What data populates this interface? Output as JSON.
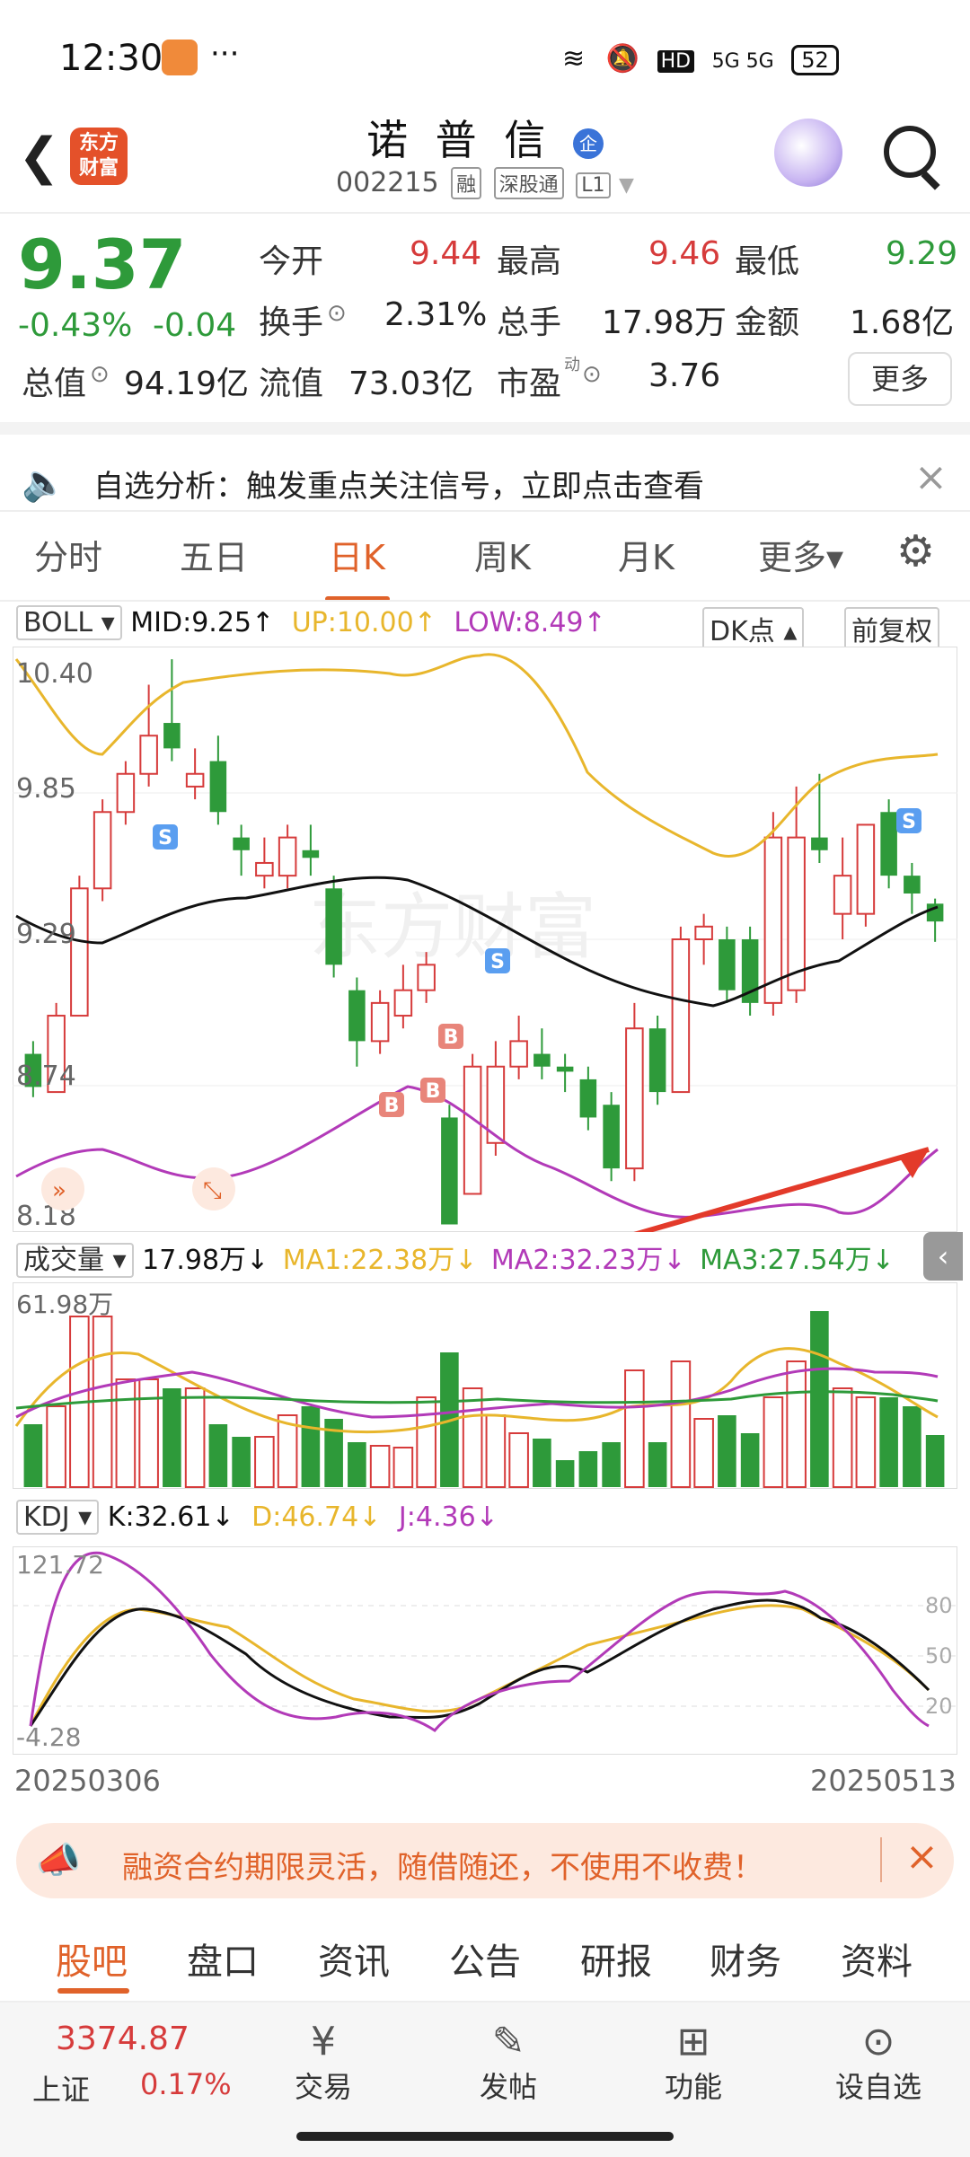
{
  "status_bar": {
    "time": "12:30",
    "dots": "···",
    "network": "5G 5G",
    "battery": "52"
  },
  "header": {
    "app_logo": "东方\n财富",
    "title": "诺 普 信",
    "badge": "企",
    "code": "002215",
    "tags": [
      "融",
      "深股通",
      "L1"
    ]
  },
  "quote": {
    "price": "9.37",
    "change_pct": "-0.43%",
    "change": "-0.04",
    "open_label": "今开",
    "open": "9.44",
    "high_label": "最高",
    "high": "9.46",
    "low_label": "最低",
    "low": "9.29",
    "turnover_label": "换手",
    "turnover": "2.31%",
    "volume_label": "总手",
    "volume": "17.98万",
    "amount_label": "金额",
    "amount": "1.68亿",
    "mktcap_label": "总值",
    "mktcap": "94.19亿",
    "float_label": "流值",
    "float_cap": "73.03亿",
    "pe_label": "市盈",
    "pe_sup": "动",
    "pe": "3.76",
    "more_label": "更多"
  },
  "notice": {
    "text": "自选分析：触发重点关注信号，立即点击查看"
  },
  "period_tabs": [
    {
      "label": "分时"
    },
    {
      "label": "五日"
    },
    {
      "label": "日K",
      "active": true
    },
    {
      "label": "周K"
    },
    {
      "label": "月K"
    },
    {
      "label": "更多▾"
    }
  ],
  "boll": {
    "selector": "BOLL",
    "mid": "MID:9.25↑",
    "up": "UP:10.00↑",
    "low": "LOW:8.49↑",
    "dk_button": "DK点",
    "adjust_button": "前复权",
    "y_labels": [
      "10.40",
      "9.85",
      "9.29",
      "8.74",
      "8.18"
    ],
    "markers": [
      "S",
      "B",
      "B",
      "B",
      "S",
      "S"
    ]
  },
  "volume": {
    "selector": "成交量",
    "total": "17.98万↓",
    "ma1": "MA1:22.38万↓",
    "ma2": "MA2:32.23万↓",
    "ma3": "MA3:27.54万↓",
    "y_max_label": "61.98万"
  },
  "kdj": {
    "selector": "KDJ",
    "k": "K:32.61↓",
    "d": "D:46.74↓",
    "j": "J:4.36↓",
    "y_top_label": "121.72",
    "y_bottom_label": "-4.28",
    "ref_levels": [
      "80",
      "50",
      "20"
    ]
  },
  "dates": {
    "start": "20250306",
    "end": "20250513"
  },
  "promo": {
    "text": "融资合约期限灵活，随借随还，不使用不收费！"
  },
  "bottom_tabs": [
    {
      "label": "股吧",
      "active": true
    },
    {
      "label": "盘口"
    },
    {
      "label": "资讯"
    },
    {
      "label": "公告"
    },
    {
      "label": "研报"
    },
    {
      "label": "财务"
    },
    {
      "label": "资料"
    }
  ],
  "nav": {
    "index_value": "3374.87",
    "index_name": "上证",
    "index_change": "0.17%",
    "items": [
      {
        "label": "交易"
      },
      {
        "label": "发帖"
      },
      {
        "label": "功能"
      },
      {
        "label": "设自选"
      }
    ]
  },
  "colors": {
    "up": "#d63b3b",
    "down": "#2e9a3a",
    "accent": "#e0622a",
    "mid_line": "#111111",
    "up_line": "#e8b62c",
    "low_line": "#b23ab8"
  }
}
